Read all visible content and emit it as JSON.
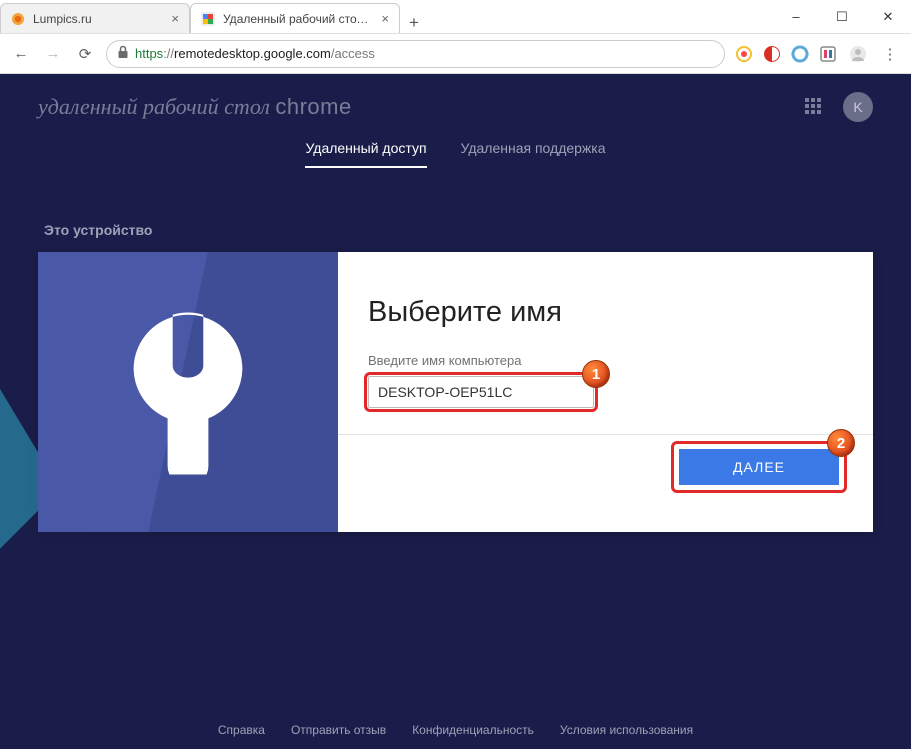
{
  "window": {
    "tab1": {
      "title": "Lumpics.ru"
    },
    "tab2": {
      "title": "Удаленный рабочий стол C"
    },
    "minimize": "–",
    "maximize": "☐",
    "close": "✕",
    "newtab": "+"
  },
  "addr": {
    "scheme": "https",
    "sep": "://",
    "host": "remotedesktop.google.com",
    "path": "/access"
  },
  "brand": {
    "left": "удаленный рабочий стол ",
    "right": "chrome"
  },
  "avatar": "K",
  "nav": {
    "tab_access": "Удаленный доступ",
    "tab_support": "Удаленная поддержка"
  },
  "section": {
    "title": "Это устройство"
  },
  "card": {
    "title": "Выберите имя",
    "label": "Введите имя компьютера",
    "value": "DESKTOP-OEP51LC",
    "next": "ДАЛЕЕ"
  },
  "marks": {
    "b1": "1",
    "b2": "2"
  },
  "footer": {
    "help": "Справка",
    "feedback": "Отправить отзыв",
    "privacy": "Конфиденциальность",
    "terms": "Условия использования"
  }
}
